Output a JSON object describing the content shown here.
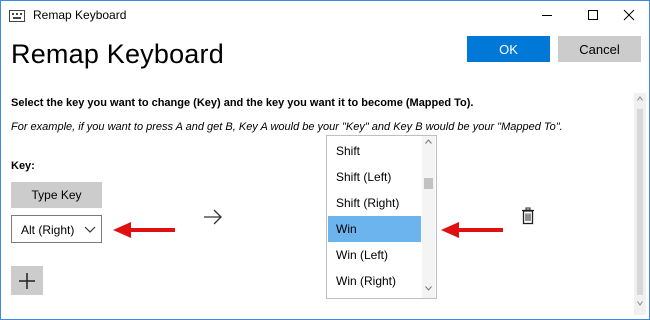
{
  "window": {
    "title": "Remap Keyboard",
    "icon": "keyboard-icon",
    "border_color": "#3a8be0"
  },
  "header": {
    "title": "Remap Keyboard",
    "ok_label": "OK",
    "cancel_label": "Cancel",
    "ok_color": "#0078d7"
  },
  "content": {
    "instruction": "Select the key you want to change (Key) and the key you want it to become (Mapped To).",
    "example": "For example, if you want to press A and get B, Key A would be your \"Key\" and Key B would be your \"Mapped To\".",
    "key_label": "Key:",
    "type_key_label": "Type Key",
    "key_value": "Alt (Right)"
  },
  "mapped_to_list": {
    "items": [
      "Shift",
      "Shift (Left)",
      "Shift (Right)",
      "Win",
      "Win (Left)",
      "Win (Right)"
    ],
    "selected": "Win",
    "selected_color": "#6cb4ee"
  },
  "annotations": {
    "arrow_color": "#e01010"
  },
  "icons": {
    "mapping_arrow": "arrow-right-icon",
    "delete": "trash-icon",
    "add": "plus-icon"
  }
}
